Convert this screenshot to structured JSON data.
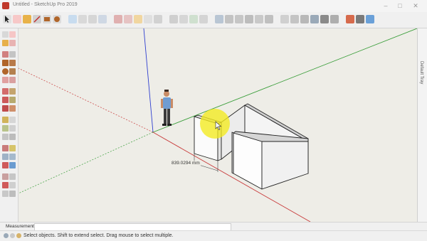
{
  "window": {
    "title": "Untitled - SketchUp Pro 2019",
    "controls": [
      "minimize",
      "maximize",
      "close"
    ]
  },
  "toolbar": {
    "icons": [
      "select-icon",
      "eraser-icon",
      "paint-icon",
      "line-icon",
      "rect-icon",
      "circle-icon",
      "orbit-icon",
      "pan-icon",
      "zoom-icon",
      "zoom-extents-icon",
      "push-pull-icon",
      "move-icon",
      "rotate-icon",
      "scale-icon",
      "offset-icon",
      "tape-icon",
      "text-icon",
      "axes-icon",
      "section-icon",
      "iso-icon",
      "top-icon",
      "front-icon",
      "right-icon",
      "back-icon",
      "left-icon",
      "xray-icon",
      "wireframe-icon",
      "hidden-line-icon",
      "shaded-icon",
      "textured-icon",
      "monochrome-icon",
      "warehouse-icon",
      "extension-icon",
      "layout-icon"
    ]
  },
  "tray": {
    "label": "Default Tray"
  },
  "viewport": {
    "dimension_label": "839.0294 mm",
    "colors": {
      "blue_axis": "#2f3fd0",
      "green_axis": "#3a9e3a",
      "red_axis": "#c83a3a",
      "highlight": "#f4ea1e",
      "background": "#eeede7"
    }
  },
  "measurements": {
    "label": "Measurements",
    "value": ""
  },
  "status": {
    "text": "Select objects. Shift to extend select. Drag mouse to select multiple."
  }
}
